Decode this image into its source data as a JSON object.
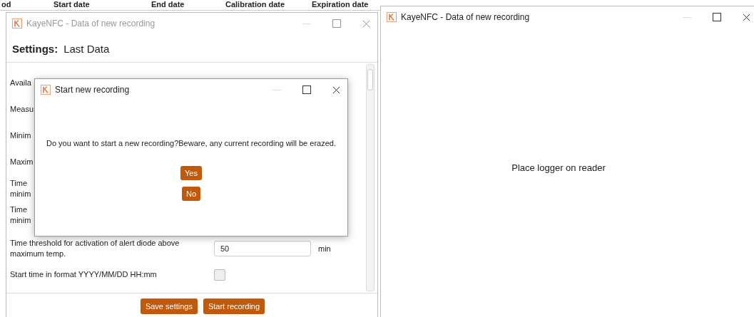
{
  "background_table": {
    "columns": [
      "od",
      "Start date",
      "End date",
      "Calibration date",
      "Expiration date"
    ]
  },
  "left_window": {
    "title": "KayeNFC - Data of new recording",
    "active": false,
    "heading_label": "Settings:",
    "heading_value": "Last Data",
    "rows": [
      {
        "kind": "text",
        "label": "Availa"
      },
      {
        "kind": "text",
        "label": "Measu"
      },
      {
        "kind": "text",
        "label": "Minim"
      },
      {
        "kind": "text",
        "label": "Maxim"
      },
      {
        "kind": "text",
        "label": "Time\nminim"
      },
      {
        "kind": "text",
        "label": "Time\nminim"
      },
      {
        "kind": "number",
        "label": "Time threshold for activation of alert diode above maximum temp.",
        "value": "50",
        "unit": "min"
      },
      {
        "kind": "checkbox",
        "label": "Start time in format YYYY/MM/DD HH:mm",
        "checked": false
      }
    ],
    "buttons": [
      "Save settings",
      "Start recording"
    ]
  },
  "dialog": {
    "title": "Start new recording",
    "active": true,
    "message": "Do you want to start a new recording?Beware, any current recording will be erazed.",
    "buttons": [
      "Yes",
      "No"
    ]
  },
  "right_window": {
    "title": "KayeNFC - Data of new recording",
    "active": true,
    "message": "Place logger on reader"
  }
}
